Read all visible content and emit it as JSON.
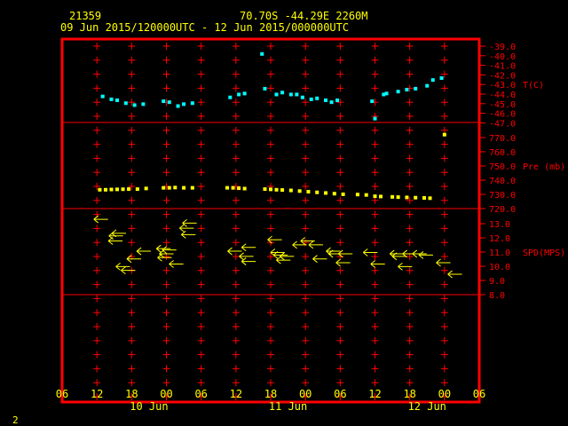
{
  "header": {
    "station_id": "21359",
    "location": "70.70S   -44.29E   2260M",
    "time_range": "09 Jun 2015/120000UTC - 12 Jun 2015/000000UTC"
  },
  "footer": {
    "page_number": "2"
  },
  "colors": {
    "background": "#000000",
    "frame": "#ff0000",
    "text": "#ffff00",
    "temp": "#00ffff",
    "pressure": "#ffff00",
    "wind": "#ffff00"
  },
  "chart_data": {
    "type": "scatter",
    "x_axis": {
      "unit": "hours since 09 Jun 06 UTC",
      "range": [
        0,
        72
      ],
      "tick_labels": [
        "06",
        "12",
        "18",
        "00",
        "06",
        "12",
        "18",
        "00",
        "06",
        "12",
        "18",
        "00",
        "06"
      ],
      "date_labels": [
        {
          "hour": 15,
          "label": "10 Jun"
        },
        {
          "hour": 39,
          "label": "11 Jun"
        },
        {
          "hour": 63,
          "label": "12 Jun"
        }
      ]
    },
    "panels": [
      {
        "name": "T(C)",
        "ticks": [
          "-39.0",
          "-40.0",
          "-41.0",
          "-42.0",
          "-43.0",
          "-44.0",
          "-45.0",
          "-46.0",
          "-47.0"
        ],
        "range": [
          -39,
          -47
        ],
        "points": [
          [
            7,
            -44.3
          ],
          [
            8.5,
            -44.6
          ],
          [
            9.5,
            -44.7
          ],
          [
            11,
            -45.0
          ],
          [
            12.5,
            -45.2
          ],
          [
            14,
            -45.1
          ],
          [
            17.5,
            -44.8
          ],
          [
            18.5,
            -44.9
          ],
          [
            20,
            -45.3
          ],
          [
            21,
            -45.1
          ],
          [
            22.5,
            -45.0
          ],
          [
            29,
            -44.4
          ],
          [
            30.5,
            -44.1
          ],
          [
            31.5,
            -44.0
          ],
          [
            34.5,
            -39.9
          ],
          [
            35,
            -43.5
          ],
          [
            37,
            -44.1
          ],
          [
            38,
            -43.9
          ],
          [
            39.5,
            -44.1
          ],
          [
            40.5,
            -44.1
          ],
          [
            41.5,
            -44.4
          ],
          [
            43,
            -44.6
          ],
          [
            44,
            -44.5
          ],
          [
            45.5,
            -44.7
          ],
          [
            46.5,
            -44.9
          ],
          [
            47.5,
            -44.7
          ],
          [
            53.5,
            -44.8
          ],
          [
            54,
            -46.6
          ],
          [
            55.5,
            -44.1
          ],
          [
            56,
            -44.0
          ],
          [
            58,
            -43.8
          ],
          [
            59.5,
            -43.6
          ],
          [
            61,
            -43.5
          ],
          [
            63,
            -43.2
          ],
          [
            64,
            -42.6
          ],
          [
            65.5,
            -42.4
          ]
        ]
      },
      {
        "name": "Pre (mb)",
        "ticks": [
          "770.0",
          "760.0",
          "750.0",
          "740.0",
          "730.0",
          "720.0"
        ],
        "range": [
          780,
          715
        ],
        "points": [
          [
            6.5,
            729.5
          ],
          [
            7.5,
            729.5
          ],
          [
            8.5,
            729.7
          ],
          [
            9.5,
            729.8
          ],
          [
            10.5,
            729.9
          ],
          [
            11.5,
            730.0
          ],
          [
            13,
            730.0
          ],
          [
            14.5,
            730.5
          ],
          [
            17.5,
            731.0
          ],
          [
            18.5,
            731.0
          ],
          [
            19.5,
            731.2
          ],
          [
            21,
            731.0
          ],
          [
            22.5,
            731.0
          ],
          [
            28.5,
            731.0
          ],
          [
            29.5,
            731.0
          ],
          [
            30.5,
            730.7
          ],
          [
            31.5,
            730.4
          ],
          [
            35,
            730.0
          ],
          [
            36,
            729.8
          ],
          [
            37,
            729.5
          ],
          [
            38,
            729.3
          ],
          [
            39.5,
            729.0
          ],
          [
            41,
            728.5
          ],
          [
            42.5,
            728.0
          ],
          [
            44,
            727.5
          ],
          [
            45.5,
            727.0
          ],
          [
            47,
            726.5
          ],
          [
            48.5,
            726.0
          ],
          [
            51,
            725.8
          ],
          [
            52.5,
            725.5
          ],
          [
            54,
            724.5
          ],
          [
            55,
            724.3
          ],
          [
            57,
            724.0
          ],
          [
            58,
            723.8
          ],
          [
            59.5,
            723.6
          ],
          [
            61,
            723.4
          ],
          [
            62.5,
            723.2
          ],
          [
            63.5,
            723.0
          ],
          [
            66,
            772.0
          ]
        ]
      },
      {
        "name": "SPD(MPS)",
        "ticks": [
          "13.0",
          "12.0",
          "11.0",
          "10.0",
          "9.0",
          "8.0"
        ],
        "range": [
          14,
          7.4
        ],
        "points": [
          [
            6.7,
            13.3
          ],
          [
            9.3,
            12.0
          ],
          [
            9.8,
            12.2
          ],
          [
            9.2,
            11.6
          ],
          [
            11.4,
            9.3
          ],
          [
            10.5,
            9.6
          ],
          [
            12.4,
            10.2
          ],
          [
            14.1,
            10.8
          ],
          [
            17.5,
            11.0
          ],
          [
            18.5,
            10.9
          ],
          [
            18.0,
            10.6
          ],
          [
            17.7,
            10.3
          ],
          [
            19.7,
            9.8
          ],
          [
            21.5,
            12.6
          ],
          [
            21.8,
            12.1
          ],
          [
            22.0,
            13.0
          ],
          [
            29.8,
            10.8
          ],
          [
            31.8,
            10.4
          ],
          [
            32.2,
            11.1
          ],
          [
            32.2,
            10.0
          ],
          [
            36.7,
            11.7
          ],
          [
            37.2,
            10.7
          ],
          [
            37.7,
            10.5
          ],
          [
            38.8,
            10.4
          ],
          [
            38.2,
            10.1
          ],
          [
            41.0,
            11.3
          ],
          [
            42.4,
            11.6
          ],
          [
            43.8,
            11.3
          ],
          [
            44.5,
            10.2
          ],
          [
            46.8,
            10.8
          ],
          [
            47.2,
            10.6
          ],
          [
            48.9,
            10.6
          ],
          [
            48.5,
            9.9
          ],
          [
            53.2,
            10.7
          ],
          [
            54.5,
            9.8
          ],
          [
            57.8,
            10.6
          ],
          [
            58.2,
            10.4
          ],
          [
            60.0,
            10.6
          ],
          [
            61.7,
            10.6
          ],
          [
            62.8,
            10.5
          ],
          [
            59.2,
            9.6
          ],
          [
            65.8,
            9.9
          ],
          [
            67.8,
            9.0
          ]
        ]
      }
    ]
  }
}
